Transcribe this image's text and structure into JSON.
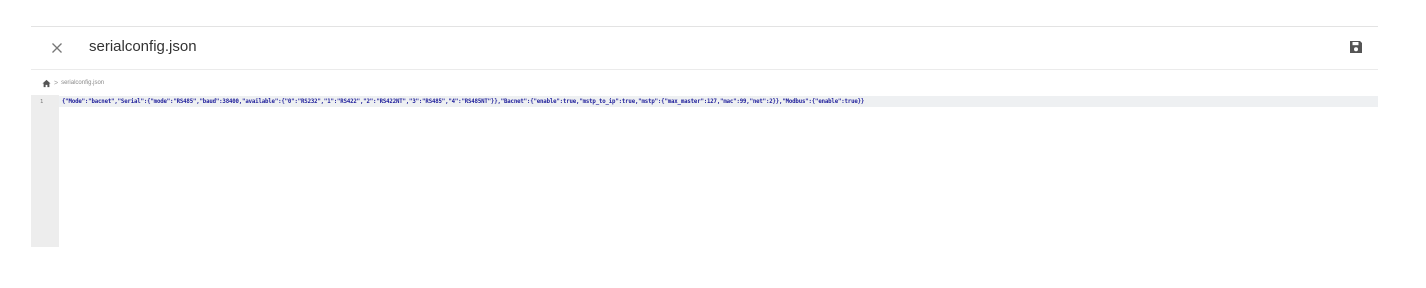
{
  "header": {
    "title": "serialconfig.json",
    "close_icon": "close-icon",
    "save_icon": "floppy-disk-save-icon"
  },
  "breadcrumb": {
    "home_icon": "home-icon",
    "separator": ">",
    "file": "serialconfig.json"
  },
  "editor": {
    "line_number": "1",
    "content": "{\"Mode\":\"bacnet\",\"Serial\":{\"mode\":\"RS485\",\"baud\":38400,\"available\":{\"0\":\"RS232\",\"1\":\"RS422\",\"2\":\"RS422NT\",\"3\":\"RS485\",\"4\":\"RS485NT\"}},\"Bacnet\":{\"enable\":true,\"mstp_to_ip\":true,\"mstp\":{\"max_master\":127,\"mac\":99,\"net\":2}},\"Modbus\":{\"enable\":true}}"
  },
  "colors": {
    "code_text": "#1f1f9b",
    "gutter_bg": "#ededed",
    "line_highlight": "#eef0f2"
  }
}
